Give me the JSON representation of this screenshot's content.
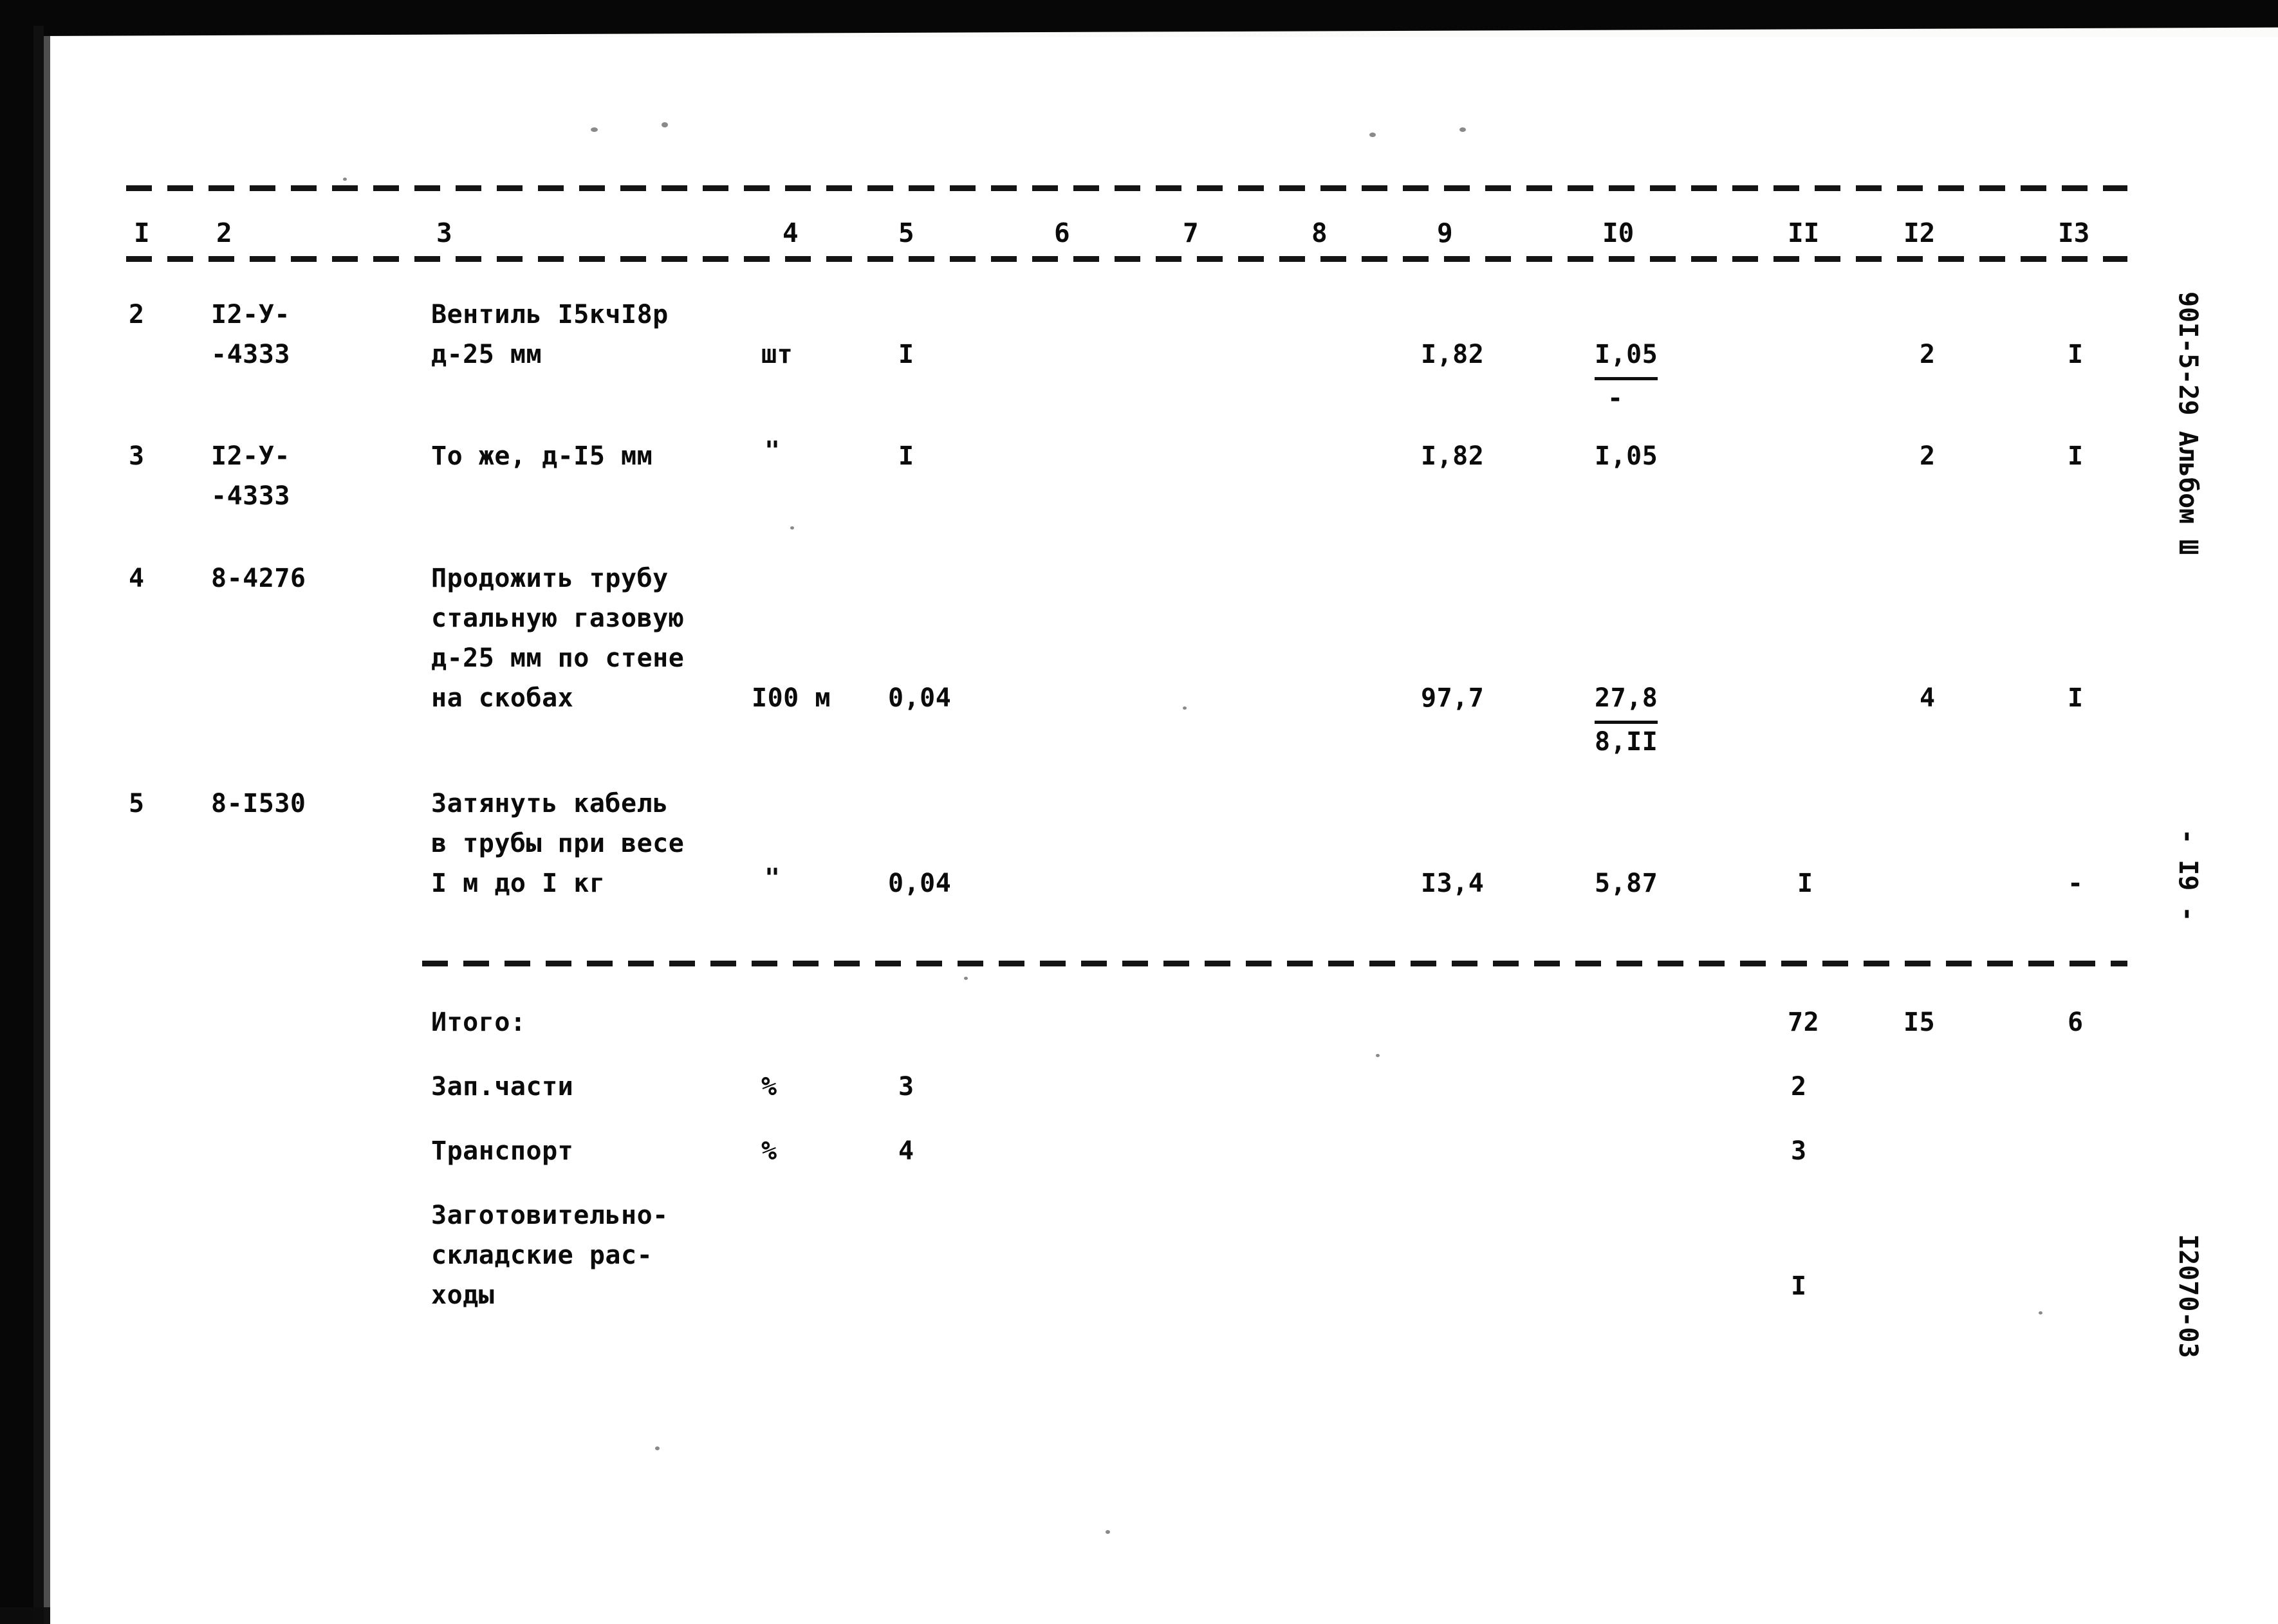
{
  "document": {
    "type": "soviet-construction-estimate-table",
    "page_number_margin": "- I9 -",
    "series_margin": "90I-5-29 Альбом Ш",
    "drawing_code_margin": "I2070-03"
  },
  "table": {
    "column_headers": [
      "I",
      "2",
      "3",
      "4",
      "5",
      "6",
      "7",
      "8",
      "9",
      "I0",
      "II",
      "I2",
      "I3"
    ],
    "rows": [
      {
        "c1": "2",
        "c2_line1": "I2-У-",
        "c2_line2": "-4333",
        "c3_line1": "Вентиль I5кчI8р",
        "c3_line2": "д-25 мм",
        "c3_line3": "",
        "c3_line4": "",
        "c4": "шт",
        "c5": "I",
        "c6": "",
        "c7": "",
        "c8": "",
        "c9": "I,82",
        "c10_top": "I,05",
        "c10_bottom": "-",
        "c11": "",
        "c12": "2",
        "c13": "I"
      },
      {
        "c1": "3",
        "c2_line1": "I2-У-",
        "c2_line2": "-4333",
        "c3_line1": "То же, д-I5 мм",
        "c3_line2": "",
        "c3_line3": "",
        "c3_line4": "",
        "c4": "\"",
        "c5": "I",
        "c6": "",
        "c7": "",
        "c8": "",
        "c9": "I,82",
        "c10_top": "I,05",
        "c10_bottom": "",
        "c11": "",
        "c12": "2",
        "c13": "I"
      },
      {
        "c1": "4",
        "c2_line1": "8-4276",
        "c2_line2": "",
        "c3_line1": "Продожить трубу",
        "c3_line2": "стальную газовую",
        "c3_line3": "д-25 мм по стене",
        "c3_line4": "на скобах",
        "c4": "I00 м",
        "c5": "0,04",
        "c6": "",
        "c7": "",
        "c8": "",
        "c9": "97,7",
        "c10_top": "27,8",
        "c10_bottom": "8,II",
        "c11": "",
        "c12": "4",
        "c13": "I"
      },
      {
        "c1": "5",
        "c2_line1": "8-I530",
        "c2_line2": "",
        "c3_line1": "Затянуть кабель",
        "c3_line2": "в трубы при весе",
        "c3_line3": "I м до I кг",
        "c3_line4": "",
        "c4": "\"",
        "c5": "0,04",
        "c6": "",
        "c7": "",
        "c8": "",
        "c9": "I3,4",
        "c10_top": "5,87",
        "c10_bottom": "",
        "c11": "I",
        "c12": "",
        "c13": "-"
      }
    ],
    "summary_rows": [
      {
        "label_line1": "Итого:",
        "label_line2": "",
        "label_line3": "",
        "unit": "",
        "qty": "",
        "c11": "72",
        "c12": "I5",
        "c13": "6"
      },
      {
        "label_line1": "Зап.части",
        "label_line2": "",
        "label_line3": "",
        "unit": "%",
        "qty": "3",
        "c11": "2",
        "c12": "",
        "c13": ""
      },
      {
        "label_line1": "Транспорт",
        "label_line2": "",
        "label_line3": "",
        "unit": "%",
        "qty": "4",
        "c11": "3",
        "c12": "",
        "c13": ""
      },
      {
        "label_line1": "Заготовительно-",
        "label_line2": "складские рас-",
        "label_line3": "ходы",
        "unit": "",
        "qty": "",
        "c11": "I",
        "c12": "",
        "c13": ""
      }
    ]
  }
}
